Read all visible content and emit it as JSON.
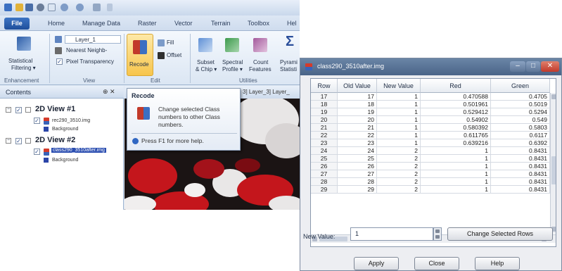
{
  "menu": {
    "file": "File",
    "tabs": [
      "Home",
      "Manage Data",
      "Raster",
      "Vector",
      "Terrain",
      "Toolbox",
      "Hel"
    ]
  },
  "ribbon": {
    "statistical_filtering": [
      "Statistical",
      "Filtering ▾"
    ],
    "group_enhancement": "Enhancement",
    "layer_combo": "Layer_1",
    "resample_combo": "Nearest Neighb-",
    "pixel_transparency": "Pixel Transparency",
    "group_view": "View",
    "recode": "Recode",
    "fill": "Fill",
    "offset": "Offset",
    "group_edit": "Edit",
    "subset_chip": [
      "Subset",
      "& Chip ▾"
    ],
    "spectral_profile": [
      "Spectral",
      "Profile ▾"
    ],
    "count_features": [
      "Count",
      "Features"
    ],
    "pyramid_statistics": [
      "Pyrami",
      "Statisti"
    ],
    "group_utilities": "Utilities",
    "sigma": "Σ"
  },
  "contents": {
    "title": "Contents",
    "pin": "⊕ ✕",
    "view1": "2D View #1",
    "view1_layer": "rec290_3510.img",
    "view1_bg": "Background",
    "view2": "2D View #2",
    "view2_layer": "class290_3510after.img",
    "view2_bg": "Background"
  },
  "viewtabs": "3] Layer_3] Layer_",
  "tooltip": {
    "title": "Recode",
    "body": "Change selected Class numbers to other Class numbers.",
    "help": "Press F1 for more help."
  },
  "dialog": {
    "title": "class290_3510after.img",
    "columns": [
      "Row",
      "Old Value",
      "New Value",
      "Red",
      "Green"
    ],
    "rows": [
      [
        "17",
        "17",
        "1",
        "0.470588",
        "0.4705"
      ],
      [
        "18",
        "18",
        "1",
        "0.501961",
        "0.5019"
      ],
      [
        "19",
        "19",
        "1",
        "0.529412",
        "0.5294"
      ],
      [
        "20",
        "20",
        "1",
        "0.54902",
        "0.549"
      ],
      [
        "21",
        "21",
        "1",
        "0.580392",
        "0.5803"
      ],
      [
        "22",
        "22",
        "1",
        "0.611765",
        "0.6117"
      ],
      [
        "23",
        "23",
        "1",
        "0.639216",
        "0.6392"
      ],
      [
        "24",
        "24",
        "2",
        "1",
        "0.8431"
      ],
      [
        "25",
        "25",
        "2",
        "1",
        "0.8431"
      ],
      [
        "26",
        "26",
        "2",
        "1",
        "0.8431"
      ],
      [
        "27",
        "27",
        "2",
        "1",
        "0.8431"
      ],
      [
        "28",
        "28",
        "2",
        "1",
        "0.8431"
      ],
      [
        "29",
        "29",
        "2",
        "1",
        "0.8431"
      ]
    ],
    "new_value_label": "New Value:",
    "new_value": "1",
    "change_selected_rows": "Change Selected Rows",
    "apply": "Apply",
    "close": "Close",
    "help": "Help"
  },
  "colors": {
    "accent": "#1f4f9b",
    "title_bar": "#4a6488",
    "raster_red": "#c4161c",
    "raster_dark": "#1b1414"
  }
}
